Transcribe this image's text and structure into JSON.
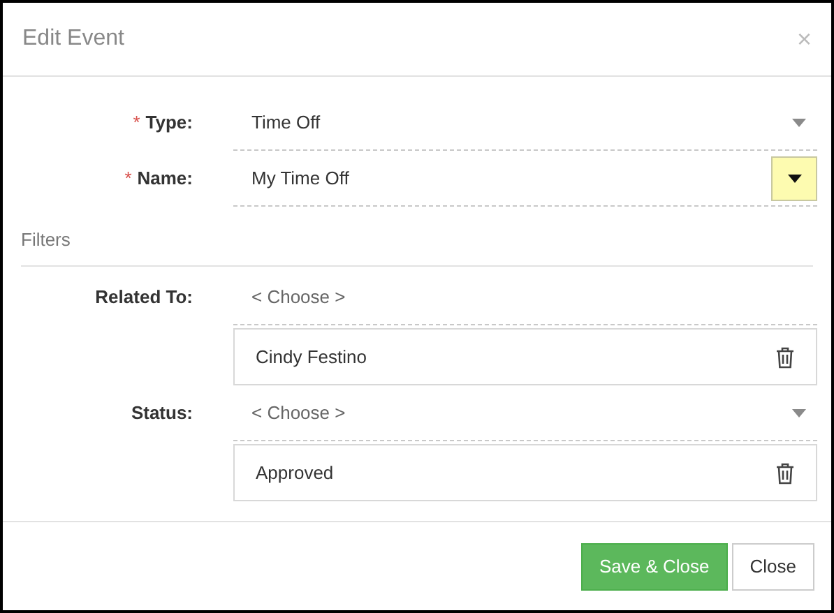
{
  "dialog": {
    "title": "Edit Event",
    "close": "×"
  },
  "fields": [
    {
      "label": "Type:",
      "required_mark": "*",
      "kind": "dropdown",
      "value": "Time Off",
      "placeholder": false
    },
    {
      "label": "Name:",
      "required_mark": "*",
      "kind": "lookup",
      "value": "My Time Off",
      "placeholder": false
    }
  ],
  "filters": {
    "heading": "Filters",
    "fields": [
      {
        "label": "Related To:",
        "kind": "chooser",
        "value": "< Choose >",
        "placeholder": true,
        "items": [
          "Cindy Festino"
        ]
      },
      {
        "label": "Status:",
        "kind": "dropdown",
        "value": "< Choose >",
        "placeholder": true,
        "items": [
          "Approved"
        ]
      }
    ]
  },
  "buttons": [
    {
      "label": "Save & Close",
      "kind": "primary"
    },
    {
      "label": "Close",
      "kind": "default"
    }
  ]
}
